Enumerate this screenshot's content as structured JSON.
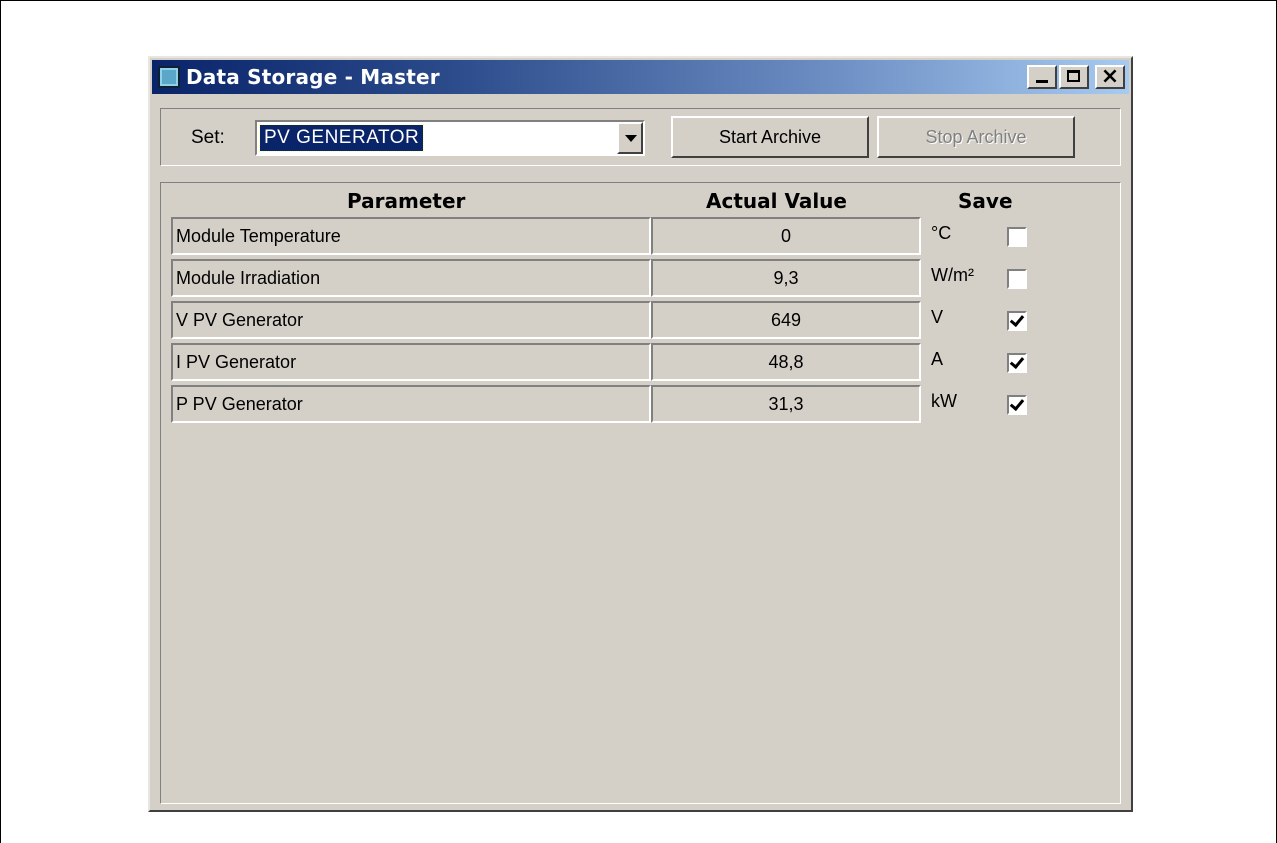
{
  "window": {
    "title": "Data Storage - Master",
    "icon": "app-window-icon",
    "controls": [
      "minimize-icon",
      "maximize-icon",
      "close-icon"
    ],
    "close_glyph": "×"
  },
  "toolbar": {
    "set_label": "Set:",
    "set_value": "PV GENERATOR",
    "start_label": "Start Archive",
    "stop_label": "Stop Archive",
    "stop_enabled": false
  },
  "table": {
    "headers": {
      "parameter": "Parameter",
      "value": "Actual Value",
      "save": "Save"
    },
    "rows": [
      {
        "parameter": "Module Temperature",
        "value": "0",
        "unit": "°C",
        "save": false
      },
      {
        "parameter": "Module Irradiation",
        "value": "9,3",
        "unit": "W/m²",
        "save": false
      },
      {
        "parameter": "V PV Generator",
        "value": "649",
        "unit": "V",
        "save": true
      },
      {
        "parameter": "I PV Generator",
        "value": "48,8",
        "unit": "A",
        "save": true
      },
      {
        "parameter": "P PV Generator",
        "value": "31,3",
        "unit": "kW",
        "save": true
      }
    ]
  },
  "colors": {
    "titlebar_start": "#0a246a",
    "titlebar_end": "#a6caf0",
    "face": "#d4d0c8",
    "selection": "#0a246a"
  }
}
